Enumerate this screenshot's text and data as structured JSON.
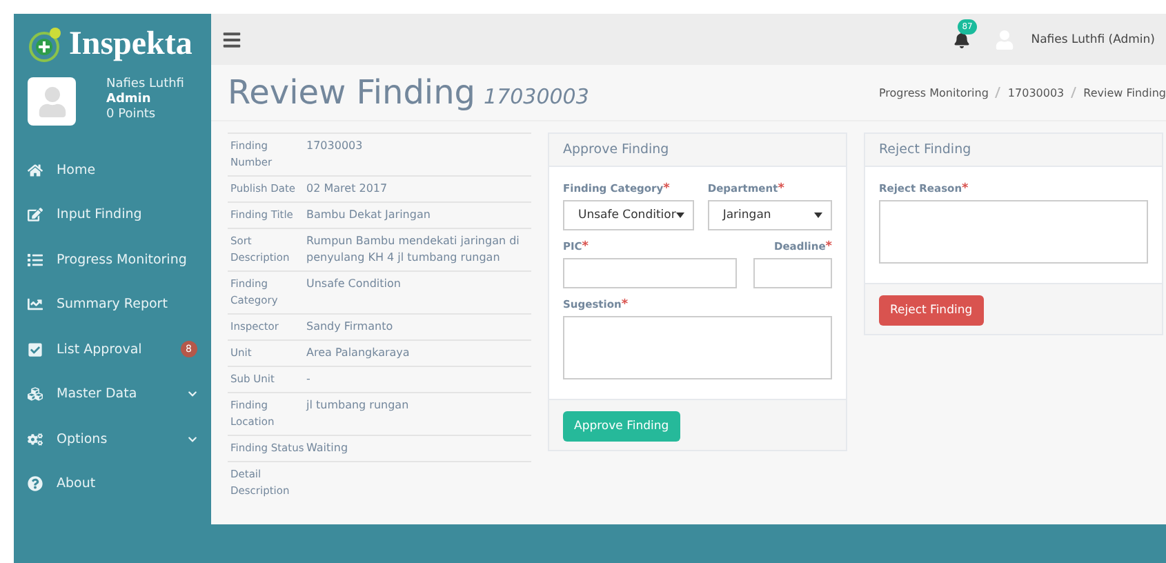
{
  "sidebar": {
    "logo": "Inspekta",
    "user": {
      "name": "Nafies Luthfi",
      "role": "Admin",
      "points": "0 Points"
    },
    "items": [
      {
        "label": "Home",
        "selected": false
      },
      {
        "label": "Input Finding",
        "selected": false
      },
      {
        "label": "Progress Monitoring",
        "selected": false
      },
      {
        "label": "Summary Report",
        "selected": false
      },
      {
        "label": "List Approval",
        "selected": false,
        "badge": "8"
      },
      {
        "label": "Master Data",
        "selected": false,
        "expandable": true
      },
      {
        "label": "Options",
        "selected": false,
        "expandable": true
      },
      {
        "label": "About",
        "selected": false
      }
    ]
  },
  "topbar": {
    "notifications": "87",
    "user": "Nafies Luthfi (Admin)"
  },
  "page": {
    "title": "Review Finding",
    "subtitle": "17030003",
    "breadcrumb": [
      "Progress Monitoring",
      "17030003",
      "Review Finding"
    ]
  },
  "details": [
    {
      "label": "Finding Number",
      "value": "17030003"
    },
    {
      "label": "Publish Date",
      "value": "02 Maret 2017"
    },
    {
      "label": "Finding Title",
      "value": "Bambu Dekat Jaringan"
    },
    {
      "label": "Sort Description",
      "value": "Rumpun Bambu mendekati jaringan di penyulang KH 4 jl tumbang rungan"
    },
    {
      "label": "Finding Category",
      "value": "Unsafe Condition"
    },
    {
      "label": "Inspector",
      "value": "Sandy Firmanto"
    },
    {
      "label": "Unit",
      "value": "Area Palangkaraya"
    },
    {
      "label": "Sub Unit",
      "value": "-"
    },
    {
      "label": "Finding Location",
      "value": "jl tumbang rungan"
    },
    {
      "label": "Finding Status",
      "value": "Waiting"
    },
    {
      "label": "Detail Description"
    }
  ],
  "approve": {
    "title": "Approve Finding",
    "fields": [
      {
        "kind": "select",
        "label": "Finding Category",
        "mark": "*",
        "value": "Unsafe Conditior"
      },
      {
        "kind": "select",
        "label": "Department",
        "mark": "*",
        "value": "Jaringan"
      },
      {
        "kind": "input",
        "label": "PIC",
        "mark": "*"
      },
      {
        "kind": "input",
        "label": "Deadline",
        "mark": "*"
      },
      {
        "kind": "textarea",
        "label": "Sugestion",
        "mark": "*"
      }
    ],
    "button": "Approve Finding"
  },
  "reject": {
    "title": "Reject Finding",
    "fields": [
      {
        "kind": "textarea",
        "label": "Reject Reason",
        "mark": "*"
      }
    ],
    "button": "Reject Finding"
  }
}
